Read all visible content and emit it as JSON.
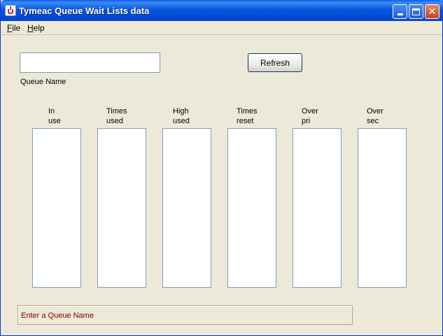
{
  "window": {
    "title": "Tymeac Queue Wait Lists data",
    "close_glyph": "✕"
  },
  "menu": {
    "file": {
      "label": "File",
      "mnemonic": "F",
      "rest": "ile"
    },
    "help": {
      "label": "Help",
      "mnemonic": "H",
      "rest": "elp"
    }
  },
  "queue": {
    "value": "",
    "label": "Queue Name"
  },
  "refresh": {
    "label": "Refresh"
  },
  "columns": [
    {
      "line1": "In",
      "line2": "use"
    },
    {
      "line1": "Times",
      "line2": "used"
    },
    {
      "line1": "High",
      "line2": "used"
    },
    {
      "line1": "Times",
      "line2": "reset"
    },
    {
      "line1": "Over",
      "line2": "pri"
    },
    {
      "line1": "Over",
      "line2": "sec"
    }
  ],
  "status": {
    "message": "Enter a Queue Name"
  },
  "colors": {
    "title_blue": "#0348D4",
    "status_text": "#800000",
    "window_bg": "#ECE9D8",
    "close_button": "#C6451C"
  }
}
